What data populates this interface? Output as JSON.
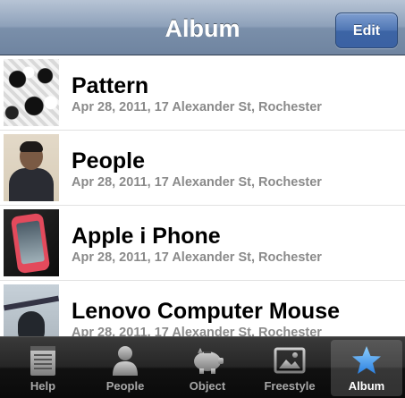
{
  "navbar": {
    "title": "Album",
    "edit_label": "Edit"
  },
  "items": [
    {
      "title": "Pattern",
      "subtitle": "Apr 28, 2011, 17 Alexander St, Rochester"
    },
    {
      "title": "People",
      "subtitle": "Apr 28, 2011, 17 Alexander St, Rochester"
    },
    {
      "title": "Apple i Phone",
      "subtitle": "Apr 28, 2011, 17 Alexander St, Rochester"
    },
    {
      "title": "Lenovo Computer Mouse",
      "subtitle": "Apr 28, 2011, 17 Alexander St, Rochester"
    }
  ],
  "tabbar": {
    "tabs": [
      {
        "label": "Help",
        "icon": "notepad-icon"
      },
      {
        "label": "People",
        "icon": "person-icon"
      },
      {
        "label": "Object",
        "icon": "piggy-bank-icon"
      },
      {
        "label": "Freestyle",
        "icon": "picture-icon"
      },
      {
        "label": "Album",
        "icon": "star-icon",
        "selected": true
      }
    ]
  },
  "colors": {
    "nav_blue": "#7a8faa",
    "edit_blue": "#4f76b4",
    "subtitle_gray": "#8a8a8a",
    "star_blue": "#3f8fe6"
  }
}
